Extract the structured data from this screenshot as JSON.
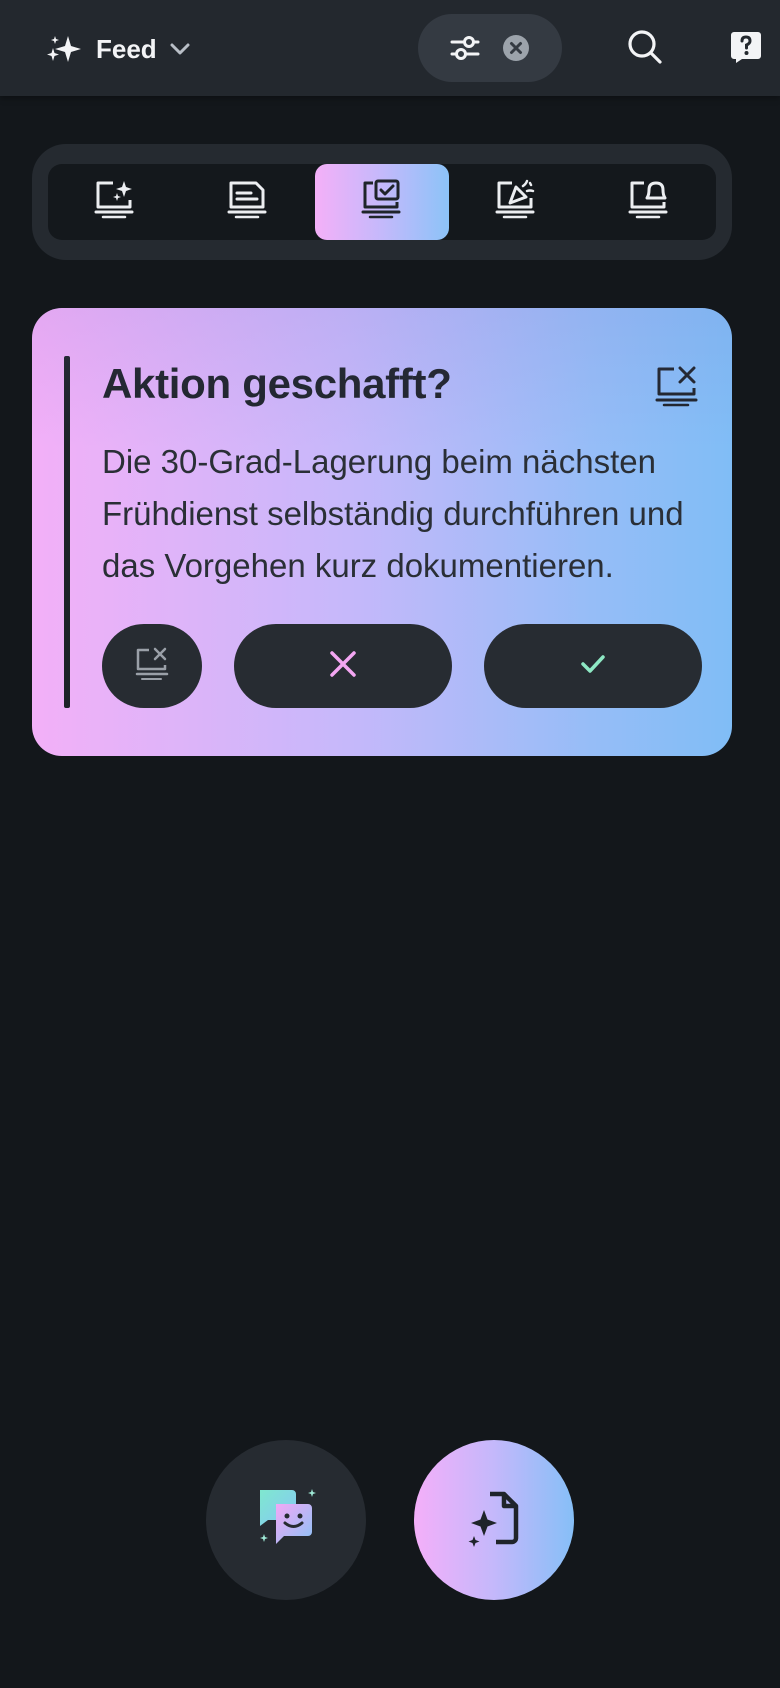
{
  "header": {
    "feed_label": "Feed",
    "icons": [
      "sparkles-icon",
      "chevron-down-icon",
      "filter-sliders-icon",
      "clear-filter-icon",
      "search-icon",
      "help-icon"
    ]
  },
  "tabs": [
    {
      "id": "all",
      "icon": "screen-sparkles-icon",
      "active": false
    },
    {
      "id": "notes",
      "icon": "screen-document-icon",
      "active": false
    },
    {
      "id": "actions",
      "icon": "screen-checkbox-icon",
      "active": true
    },
    {
      "id": "celebrations",
      "icon": "screen-party-icon",
      "active": false
    },
    {
      "id": "reminders",
      "icon": "screen-bell-icon",
      "active": false
    }
  ],
  "card": {
    "title": "Aktion geschafft?",
    "body": "Die 30-Grad-Lagerung beim nächsten Frühdienst selbständig durchführen und das Vorgehen kurz dokumentieren.",
    "colors": {
      "gradient_start": "#f3b0f8",
      "gradient_end": "#80bdf6",
      "no_accent": "#f3a6f2",
      "yes_accent": "#8ee8c4"
    }
  },
  "fabs": {
    "chat_icon": "chat-smiley-icon",
    "create_icon": "document-sparkle-icon"
  }
}
